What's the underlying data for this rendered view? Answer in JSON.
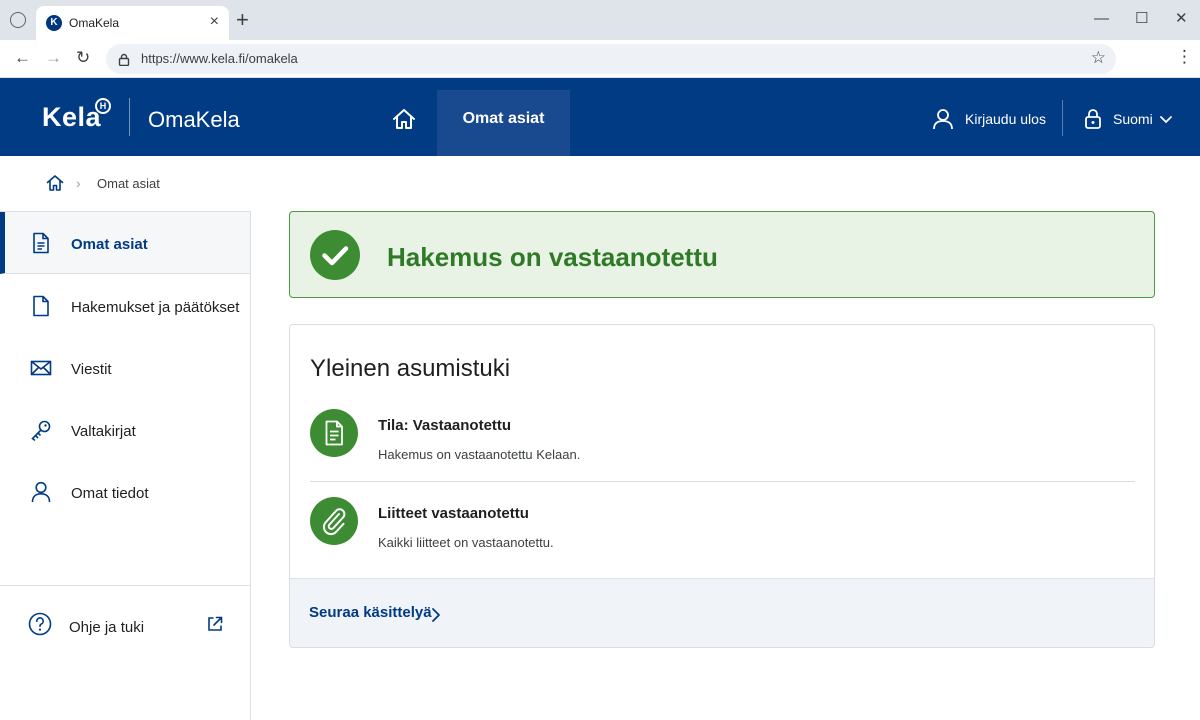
{
  "browser": {
    "tab_title": "OmaKela",
    "favicon_text": "K",
    "url": "https://www.kela.fi/omakela"
  },
  "header": {
    "logo": "Kela",
    "logo_mark": "H",
    "service_name": "OmaKela",
    "nav_active": "Omat asiat",
    "logout": "Kirjaudu ulos",
    "language": "Suomi",
    "brand_color": "#003b84"
  },
  "breadcrumb": {
    "current": "Omat asiat"
  },
  "sidebar": {
    "items": [
      {
        "label": "Omat asiat",
        "icon": "document-icon",
        "active": true
      },
      {
        "label": "Hakemukset ja päätökset",
        "icon": "file-icon",
        "active": false
      },
      {
        "label": "Viestit",
        "icon": "mail-icon",
        "active": false
      },
      {
        "label": "Valtakirjat",
        "icon": "key-icon",
        "active": false
      },
      {
        "label": "Omat tiedot",
        "icon": "person-icon",
        "active": false
      }
    ],
    "help": {
      "label": "Ohje ja tuki",
      "icon": "help-icon",
      "external": true
    }
  },
  "main": {
    "success_message": "Hakemus on vastaanotettu",
    "success_color": "#2f7a27",
    "card": {
      "title": "Yleinen asumistuki",
      "rows": [
        {
          "icon": "document-icon",
          "title": "Tila: Vastaanotettu",
          "description": "Hakemus on vastaanotettu Kelaan."
        },
        {
          "icon": "paperclip-icon",
          "title": "Liitteet vastaanotettu",
          "description": "Kaikki liitteet on vastaanotettu."
        }
      ],
      "footer_link": "Seuraa käsittelyä"
    }
  }
}
